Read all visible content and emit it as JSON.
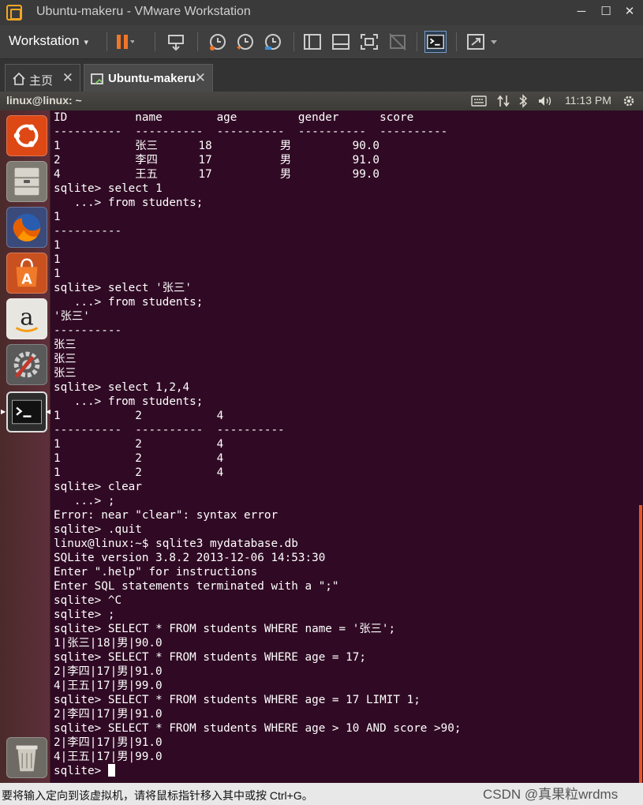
{
  "window": {
    "title": "Ubuntu-makeru - VMware Workstation",
    "minimize": "─",
    "maximize": "☐",
    "close": "✕"
  },
  "toolbar": {
    "menu_label": "Workstation",
    "caret": "▾",
    "icons": [
      "pause-icon",
      "send-keys-icon",
      "snapshot-icon",
      "revert-snapshot-icon",
      "snapshot-manager-icon",
      "sidebar-icon",
      "thumbnail-icon",
      "fullscreen-icon",
      "unity-icon",
      "console-icon",
      "stretch-icon"
    ]
  },
  "tabs": [
    {
      "label": "主页",
      "icon": "home-icon",
      "close": "✕",
      "active": false
    },
    {
      "label": "Ubuntu-makeru",
      "icon": "vm-icon",
      "close": "✕",
      "active": true
    }
  ],
  "ubuntu_panel": {
    "window_title": "linux@linux: ~",
    "time": "11:13 PM",
    "indicators": [
      "keyboard-icon",
      "network-icon",
      "bluetooth-icon",
      "volume-icon",
      "settings-gear-icon"
    ]
  },
  "launcher": {
    "items": [
      "ubuntu-dash-icon",
      "files-icon",
      "firefox-icon",
      "software-center-icon",
      "amazon-icon",
      "system-settings-icon",
      "terminal-icon",
      "trash-icon"
    ]
  },
  "terminal": {
    "lines": [
      "ID          name        age         gender      score",
      "----------  ----------  ----------  ----------  ----------",
      "1           张三      18          男         90.0",
      "2           李四      17          男         91.0",
      "4           王五      17          男         99.0",
      "sqlite> select 1",
      "   ...> from students;",
      "1",
      "----------",
      "1",
      "1",
      "1",
      "sqlite> select '张三'",
      "   ...> from students;",
      "'张三'",
      "----------",
      "张三",
      "张三",
      "张三",
      "sqlite> select 1,2,4",
      "   ...> from students;",
      "1           2           4",
      "----------  ----------  ----------",
      "1           2           4",
      "1           2           4",
      "1           2           4",
      "sqlite> clear",
      "   ...> ;",
      "Error: near \"clear\": syntax error",
      "sqlite> .quit",
      "linux@linux:~$ sqlite3 mydatabase.db",
      "SQLite version 3.8.2 2013-12-06 14:53:30",
      "Enter \".help\" for instructions",
      "Enter SQL statements terminated with a \";\"",
      "sqlite> ^C",
      "sqlite> ;",
      "sqlite> SELECT * FROM students WHERE name = '张三';",
      "1|张三|18|男|90.0",
      "sqlite> SELECT * FROM students WHERE age = 17;",
      "2|李四|17|男|91.0",
      "4|王五|17|男|99.0",
      "sqlite> SELECT * FROM students WHERE age = 17 LIMIT 1;",
      "2|李四|17|男|91.0",
      "sqlite> SELECT * FROM students WHERE age > 10 AND score >90;",
      "2|李四|17|男|91.0",
      "4|王五|17|男|99.0"
    ],
    "prompt": "sqlite> "
  },
  "statusbar": {
    "message": "要将输入定向到该虚拟机，请将鼠标指针移入其中或按 Ctrl+G。",
    "watermark": "CSDN @真果粒wrdms"
  }
}
